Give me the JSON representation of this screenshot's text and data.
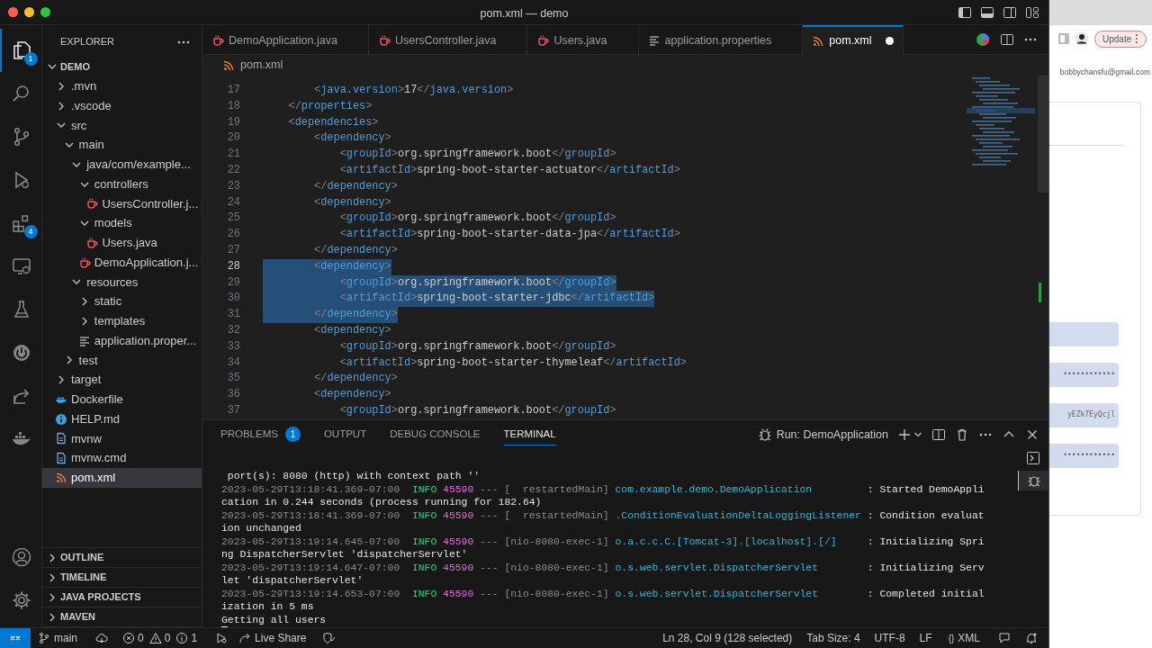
{
  "window": {
    "title": "pom.xml — demo"
  },
  "activity_bar": {
    "items": [
      {
        "kind": "explorer",
        "selected": true,
        "badge": "1"
      },
      {
        "kind": "search",
        "selected": false
      },
      {
        "kind": "source_control",
        "selected": false
      },
      {
        "kind": "run_debug",
        "selected": false
      },
      {
        "kind": "extensions",
        "selected": false,
        "badge": "4"
      },
      {
        "kind": "remote",
        "selected": false
      },
      {
        "kind": "testing",
        "selected": false
      },
      {
        "kind": "power",
        "selected": false
      },
      {
        "kind": "live_share",
        "selected": false
      },
      {
        "kind": "docker",
        "selected": false
      }
    ],
    "bottom": [
      {
        "kind": "account"
      },
      {
        "kind": "settings"
      }
    ]
  },
  "sidebar": {
    "title": "EXPLORER",
    "root": {
      "label": "DEMO",
      "expanded": true,
      "children": [
        {
          "label": ".mvn",
          "kind": "folder",
          "expanded": false,
          "selected": false
        },
        {
          "label": ".vscode",
          "kind": "folder",
          "expanded": false,
          "selected": false
        },
        {
          "label": "src",
          "kind": "folder",
          "expanded": true,
          "selected": false,
          "children": [
            {
              "label": "main",
              "kind": "folder",
              "expanded": true,
              "selected": false,
              "children": [
                {
                  "label": "java/com/example...",
                  "kind": "folder",
                  "expanded": true,
                  "selected": false,
                  "children": [
                    {
                      "label": "controllers",
                      "kind": "folder",
                      "expanded": true,
                      "selected": false,
                      "children": [
                        {
                          "label": "UsersController.j...",
                          "kind": "java",
                          "selected": false
                        }
                      ]
                    },
                    {
                      "label": "models",
                      "kind": "folder",
                      "expanded": true,
                      "selected": false,
                      "children": [
                        {
                          "label": "Users.java",
                          "kind": "java",
                          "selected": false
                        }
                      ]
                    },
                    {
                      "label": "DemoApplication.j...",
                      "kind": "java",
                      "selected": false
                    }
                  ]
                },
                {
                  "label": "resources",
                  "kind": "folder",
                  "expanded": true,
                  "selected": false,
                  "children": [
                    {
                      "label": "static",
                      "kind": "folder",
                      "expanded": false,
                      "selected": false
                    },
                    {
                      "label": "templates",
                      "kind": "folder",
                      "expanded": false,
                      "selected": false
                    },
                    {
                      "label": "application.proper...",
                      "kind": "properties",
                      "selected": false
                    }
                  ]
                }
              ]
            },
            {
              "label": "test",
              "kind": "folder",
              "expanded": false,
              "selected": false
            }
          ]
        },
        {
          "label": "target",
          "kind": "folder",
          "expanded": false,
          "selected": false
        },
        {
          "label": "Dockerfile",
          "kind": "docker",
          "selected": false
        },
        {
          "label": "HELP.md",
          "kind": "markdown",
          "selected": false
        },
        {
          "label": "mvnw",
          "kind": "script",
          "selected": false
        },
        {
          "label": "mvnw.cmd",
          "kind": "script",
          "selected": false
        },
        {
          "label": "pom.xml",
          "kind": "xml",
          "selected": true
        }
      ]
    },
    "sections": [
      {
        "label": "OUTLINE",
        "expanded": false
      },
      {
        "label": "TIMELINE",
        "expanded": false
      },
      {
        "label": "JAVA PROJECTS",
        "expanded": false
      },
      {
        "label": "MAVEN",
        "expanded": false
      }
    ]
  },
  "tabs": [
    {
      "label": "DemoApplication.java",
      "kind": "java",
      "selected": false,
      "modified": false
    },
    {
      "label": "UsersController.java",
      "kind": "java",
      "selected": false,
      "modified": false
    },
    {
      "label": "Users.java",
      "kind": "java",
      "selected": false,
      "modified": false
    },
    {
      "label": "application.properties",
      "kind": "properties",
      "selected": false,
      "modified": false
    },
    {
      "label": "pom.xml",
      "kind": "xml",
      "selected": true,
      "modified": true
    }
  ],
  "breadcrumb": [
    {
      "label": "pom.xml",
      "kind": "xml"
    }
  ],
  "editor": {
    "lines": [
      {
        "number": "17",
        "text": "        <java.version>17</java.version>",
        "selected": false,
        "active": false
      },
      {
        "number": "18",
        "text": "    </properties>",
        "selected": false,
        "active": false
      },
      {
        "number": "19",
        "text": "    <dependencies>",
        "selected": false,
        "active": false
      },
      {
        "number": "20",
        "text": "        <dependency>",
        "selected": false,
        "active": false
      },
      {
        "number": "21",
        "text": "            <groupId>org.springframework.boot</groupId>",
        "selected": false,
        "active": false
      },
      {
        "number": "22",
        "text": "            <artifactId>spring-boot-starter-actuator</artifactId>",
        "selected": false,
        "active": false
      },
      {
        "number": "23",
        "text": "        </dependency>",
        "selected": false,
        "active": false
      },
      {
        "number": "24",
        "text": "        <dependency>",
        "selected": false,
        "active": false
      },
      {
        "number": "25",
        "text": "            <groupId>org.springframework.boot</groupId>",
        "selected": false,
        "active": false
      },
      {
        "number": "26",
        "text": "            <artifactId>spring-boot-starter-data-jpa</artifactId>",
        "selected": false,
        "active": false
      },
      {
        "number": "27",
        "text": "        </dependency>",
        "selected": false,
        "active": false
      },
      {
        "number": "28",
        "text": "        <dependency>",
        "selected": true,
        "active": true
      },
      {
        "number": "29",
        "text": "            <groupId>org.springframework.boot</groupId>",
        "selected": true,
        "active": false
      },
      {
        "number": "30",
        "text": "            <artifactId>spring-boot-starter-jdbc</artifactId>",
        "selected": true,
        "active": false
      },
      {
        "number": "31",
        "text": "        </dependency>",
        "selected": true,
        "active": false
      },
      {
        "number": "32",
        "text": "        <dependency>",
        "selected": false,
        "active": false
      },
      {
        "number": "33",
        "text": "            <groupId>org.springframework.boot</groupId>",
        "selected": false,
        "active": false
      },
      {
        "number": "34",
        "text": "            <artifactId>spring-boot-starter-thymeleaf</artifactId>",
        "selected": false,
        "active": false
      },
      {
        "number": "35",
        "text": "        </dependency>",
        "selected": false,
        "active": false
      },
      {
        "number": "36",
        "text": "        <dependency>",
        "selected": false,
        "active": false
      },
      {
        "number": "37",
        "text": "            <groupId>org.springframework.boot</groupId>",
        "selected": false,
        "active": false
      }
    ]
  },
  "panel": {
    "tabs": [
      {
        "label": "PROBLEMS",
        "badge": "1",
        "selected": false
      },
      {
        "label": "OUTPUT",
        "selected": false
      },
      {
        "label": "DEBUG CONSOLE",
        "selected": false
      },
      {
        "label": "TERMINAL",
        "selected": true
      }
    ],
    "run_label": "Run: DemoApplication",
    "terminal": [
      {
        "segments": [
          {
            "kind": "plain",
            "text": " port(s): 8080 (http) with context path ''"
          }
        ]
      },
      {
        "segments": [
          {
            "kind": "time",
            "text": "2023-05-29T13:18:41.369-07:00"
          },
          {
            "kind": "level",
            "text": "INFO"
          },
          {
            "kind": "pid",
            "text": "45590"
          },
          {
            "kind": "separator",
            "text": "---"
          },
          {
            "kind": "thread",
            "text": "[  restartedMain]"
          },
          {
            "kind": "logger",
            "text": "com.example.demo.DemoApplication"
          },
          {
            "kind": "message",
            "text": ": Started DemoAppli"
          }
        ]
      },
      {
        "segments": [
          {
            "kind": "plain",
            "text": "cation in 0.244 seconds (process running for 182.64)"
          }
        ]
      },
      {
        "segments": [
          {
            "kind": "time",
            "text": "2023-05-29T13:18:41.369-07:00"
          },
          {
            "kind": "level",
            "text": "INFO"
          },
          {
            "kind": "pid",
            "text": "45590"
          },
          {
            "kind": "separator",
            "text": "---"
          },
          {
            "kind": "thread",
            "text": "[  restartedMain]"
          },
          {
            "kind": "logger",
            "text": ".ConditionEvaluationDeltaLoggingListener"
          },
          {
            "kind": "message",
            "text": ": Condition evaluat"
          }
        ]
      },
      {
        "segments": [
          {
            "kind": "plain",
            "text": "ion unchanged"
          }
        ]
      },
      {
        "segments": [
          {
            "kind": "time",
            "text": "2023-05-29T13:19:14.645-07:00"
          },
          {
            "kind": "level",
            "text": "INFO"
          },
          {
            "kind": "pid",
            "text": "45590"
          },
          {
            "kind": "separator",
            "text": "---"
          },
          {
            "kind": "thread",
            "text": "[nio-8080-exec-1]"
          },
          {
            "kind": "logger",
            "text": "o.a.c.c.C.[Tomcat-3].[localhost].[/]"
          },
          {
            "kind": "message",
            "text": ": Initializing Spri"
          }
        ]
      },
      {
        "segments": [
          {
            "kind": "plain",
            "text": "ng DispatcherServlet 'dispatcherServlet'"
          }
        ]
      },
      {
        "segments": [
          {
            "kind": "time",
            "text": "2023-05-29T13:19:14.647-07:00"
          },
          {
            "kind": "level",
            "text": "INFO"
          },
          {
            "kind": "pid",
            "text": "45590"
          },
          {
            "kind": "separator",
            "text": "---"
          },
          {
            "kind": "thread",
            "text": "[nio-8080-exec-1]"
          },
          {
            "kind": "logger",
            "text": "o.s.web.servlet.DispatcherServlet"
          },
          {
            "kind": "message",
            "text": ": Initializing Serv"
          }
        ]
      },
      {
        "segments": [
          {
            "kind": "plain",
            "text": "let 'dispatcherServlet'"
          }
        ]
      },
      {
        "segments": [
          {
            "kind": "time",
            "text": "2023-05-29T13:19:14.653-07:00"
          },
          {
            "kind": "level",
            "text": "INFO"
          },
          {
            "kind": "pid",
            "text": "45590"
          },
          {
            "kind": "separator",
            "text": "---"
          },
          {
            "kind": "thread",
            "text": "[nio-8080-exec-1]"
          },
          {
            "kind": "logger",
            "text": "o.s.web.servlet.DispatcherServlet"
          },
          {
            "kind": "message",
            "text": ": Completed initial"
          }
        ]
      },
      {
        "segments": [
          {
            "kind": "plain",
            "text": "ization in 5 ms"
          }
        ]
      },
      {
        "segments": [
          {
            "kind": "plain",
            "text": "Getting all users"
          }
        ]
      }
    ]
  },
  "status_bar": {
    "branch": "main",
    "errors": "0",
    "warnings": "0",
    "infos": "1",
    "live_share": "Live Share",
    "position": "Ln 28, Col 9 (128 selected)",
    "tab_size": "Tab Size: 4",
    "encoding": "UTF-8",
    "eol": "LF",
    "language_glyph": "{}",
    "language": "XML"
  },
  "browser": {
    "update_button": "Update",
    "email": "bobbychansfu@gmail.com",
    "fields": [
      {
        "kind": "empty"
      },
      {
        "kind": "filled",
        "value": "••••••••••••"
      },
      {
        "kind": "filled",
        "value": "yEZk7EyQcjl"
      },
      {
        "kind": "filled",
        "value": "••••••••••••"
      }
    ]
  }
}
